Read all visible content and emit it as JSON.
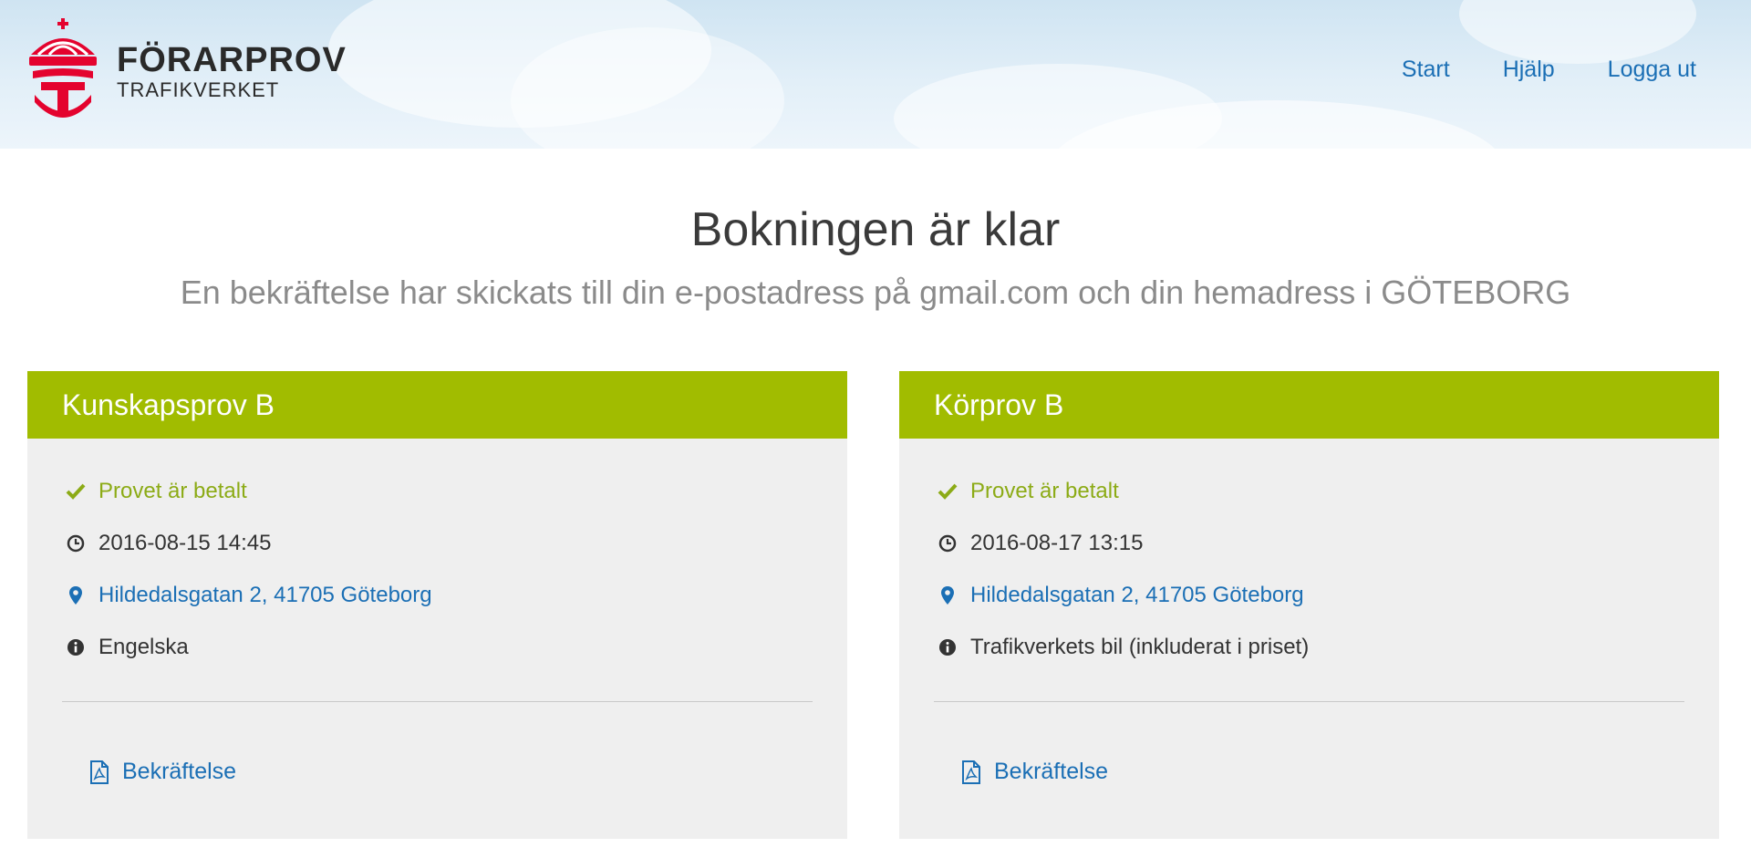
{
  "header": {
    "logo_title": "FÖRARPROV",
    "logo_subtitle": "TRAFIKVERKET",
    "nav": [
      "Start",
      "Hjälp",
      "Logga ut"
    ]
  },
  "main": {
    "title": "Bokningen är klar",
    "subtitle": "En bekräftelse har skickats till din e-postadress på gmail.com och din hemadress i GÖTEBORG"
  },
  "cards": [
    {
      "title": "Kunskapsprov B",
      "paid": "Provet är betalt",
      "datetime": "2016-08-15 14:45",
      "location": "Hildedalsgatan 2, 41705 Göteborg",
      "info": "Engelska",
      "doc_link": "Bekräftelse"
    },
    {
      "title": "Körprov B",
      "paid": "Provet är betalt",
      "datetime": "2016-08-17 13:15",
      "location": "Hildedalsgatan 2, 41705 Göteborg",
      "info": "Trafikverkets bil (inkluderat i priset)",
      "doc_link": "Bekräftelse"
    }
  ],
  "icons": {
    "paid": "check-icon",
    "datetime": "clock-icon",
    "location": "map-marker-icon",
    "info": "info-circle-icon",
    "doc": "pdf-file-icon"
  },
  "colors": {
    "accent_green": "#a1bc00",
    "paid_text": "#8cab16",
    "link_blue": "#1b6fb5"
  }
}
